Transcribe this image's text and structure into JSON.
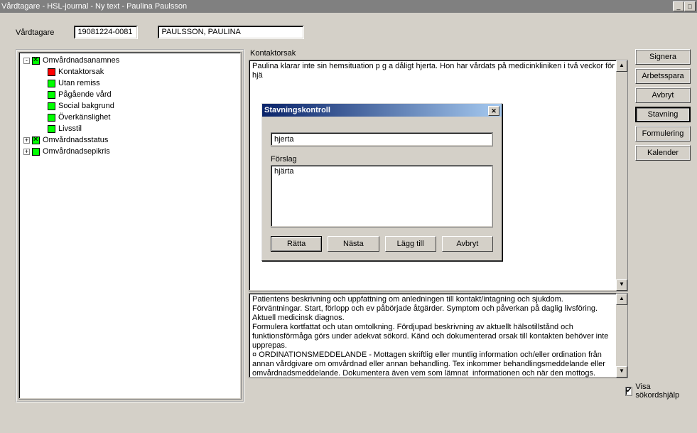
{
  "title": "Vårdtagare - HSL-journal - Ny text - Paulina Paulsson",
  "form": {
    "label": "Vårdtagare",
    "pid": "19081224-0081",
    "name": "PAULSSON, PAULINA"
  },
  "tree": [
    {
      "level": 0,
      "exp": "-",
      "color": "green",
      "check": true,
      "label": "Omvårdnadsanamnes"
    },
    {
      "level": 1,
      "exp": "",
      "color": "red",
      "check": false,
      "label": "Kontaktorsak"
    },
    {
      "level": 1,
      "exp": "",
      "color": "green",
      "check": false,
      "label": "Utan remiss"
    },
    {
      "level": 1,
      "exp": "",
      "color": "green",
      "check": false,
      "label": "Pågående vård"
    },
    {
      "level": 1,
      "exp": "",
      "color": "green",
      "check": false,
      "label": "Social bakgrund"
    },
    {
      "level": 1,
      "exp": "",
      "color": "green",
      "check": false,
      "label": "Överkänslighet"
    },
    {
      "level": 1,
      "exp": "",
      "color": "green",
      "check": false,
      "label": "Livsstil"
    },
    {
      "level": 0,
      "exp": "+",
      "color": "green",
      "check": true,
      "label": "Omvårdnadsstatus"
    },
    {
      "level": 0,
      "exp": "+",
      "color": "green",
      "check": false,
      "label": "Omvårdnadsepikris"
    }
  ],
  "section": {
    "title": "Kontaktorsak",
    "text": "Paulina klarar inte sin hemsituation p g a dåligt hjerta. Hon har vårdats på medicinkliniken i två veckor för hjä"
  },
  "help_text": "Patientens beskrivning och uppfattning om anledningen till kontakt/intagning och sjukdom. Förväntningar. Start, förlopp och ev påbörjade åtgärder. Symptom och påverkan på daglig livsföring. Aktuell medicinsk diagnos.\nFormulera kortfattat och utan omtolkning. Fördjupad beskrivning av aktuellt hälsotillstånd och funktionsförmåga görs under adekvat sökord. Känd och dokumenterad orsak till kontakten behöver inte upprepas.\n¤ ORDINATIONSMEDDELANDE - Mottagen skriftlig eller muntlig information och/eller ordination från annan vårdgivare om omvårdnad eller annan behandling. Tex inkommer behandlingsmeddelande eller omvårdnadsmeddelande. Dokumentera även vem som lämnat  informationen och när den mottogs.",
  "sidebar": {
    "signera": "Signera",
    "arbetsspara": "Arbetsspara",
    "avbryt": "Avbryt",
    "stavning": "Stavning",
    "formulering": "Formulering",
    "kalender": "Kalender"
  },
  "checkbox": {
    "label": "Visa sökordshjälp",
    "checked": true
  },
  "dialog": {
    "title": "Stavningskontroll",
    "word": "hjerta",
    "suggest_label": "Förslag",
    "suggestion": "hjärta",
    "btn_correct": "Rätta",
    "btn_next": "Nästa",
    "btn_add": "Lägg till",
    "btn_cancel": "Avbryt"
  }
}
